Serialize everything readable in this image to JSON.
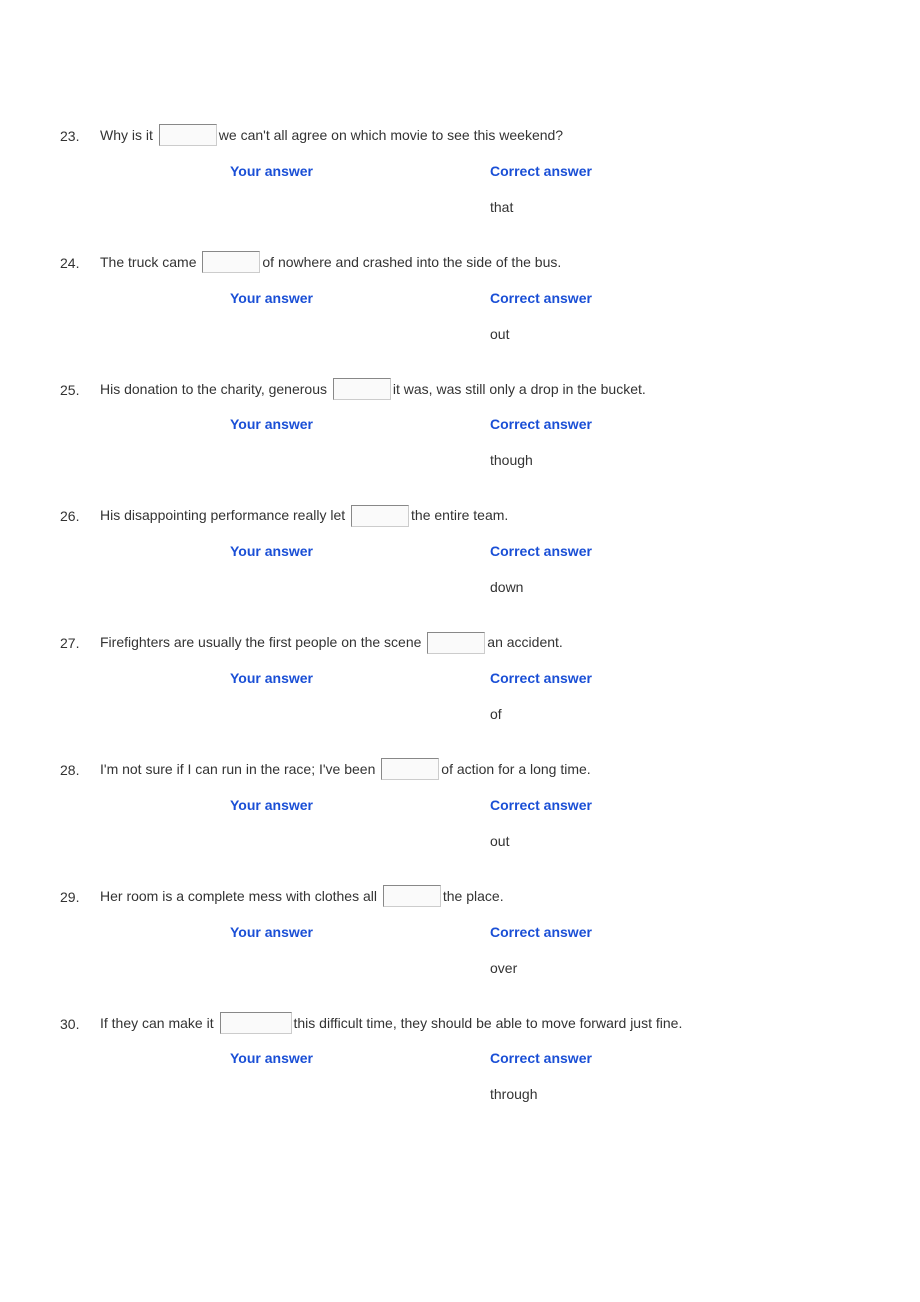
{
  "labels": {
    "your_answer": "Your answer",
    "correct_answer": "Correct answer"
  },
  "questions": [
    {
      "num": "23.",
      "parts": [
        "Why is it ",
        "we can't all agree on which movie to see this weekend?"
      ],
      "your": "",
      "correct": "that",
      "wide": false
    },
    {
      "num": "24.",
      "parts": [
        "The truck came ",
        "of nowhere and crashed into the side of the bus."
      ],
      "your": "",
      "correct": "out",
      "wide": false
    },
    {
      "num": "25.",
      "parts": [
        "His donation to the charity, generous ",
        "it was, was still only a drop in the bucket."
      ],
      "your": "",
      "correct": "though",
      "wide": false
    },
    {
      "num": "26.",
      "parts": [
        "His disappointing performance really let ",
        "the entire team."
      ],
      "your": "",
      "correct": "down",
      "wide": false
    },
    {
      "num": "27.",
      "parts": [
        "Firefighters are usually the first people on the scene ",
        "an accident."
      ],
      "your": "",
      "correct": "of",
      "wide": false
    },
    {
      "num": "28.",
      "parts": [
        "I'm not sure if I can run in the race; I've been ",
        "of action for a long time."
      ],
      "your": "",
      "correct": "out",
      "wide": false
    },
    {
      "num": "29.",
      "parts": [
        "Her room is a complete mess with clothes all ",
        "the place."
      ],
      "your": "",
      "correct": "over",
      "wide": false
    },
    {
      "num": "30.",
      "parts": [
        "If they can make it ",
        "this difficult time, they should be able to move forward just fine."
      ],
      "your": "",
      "correct": "through",
      "wide": true
    }
  ]
}
